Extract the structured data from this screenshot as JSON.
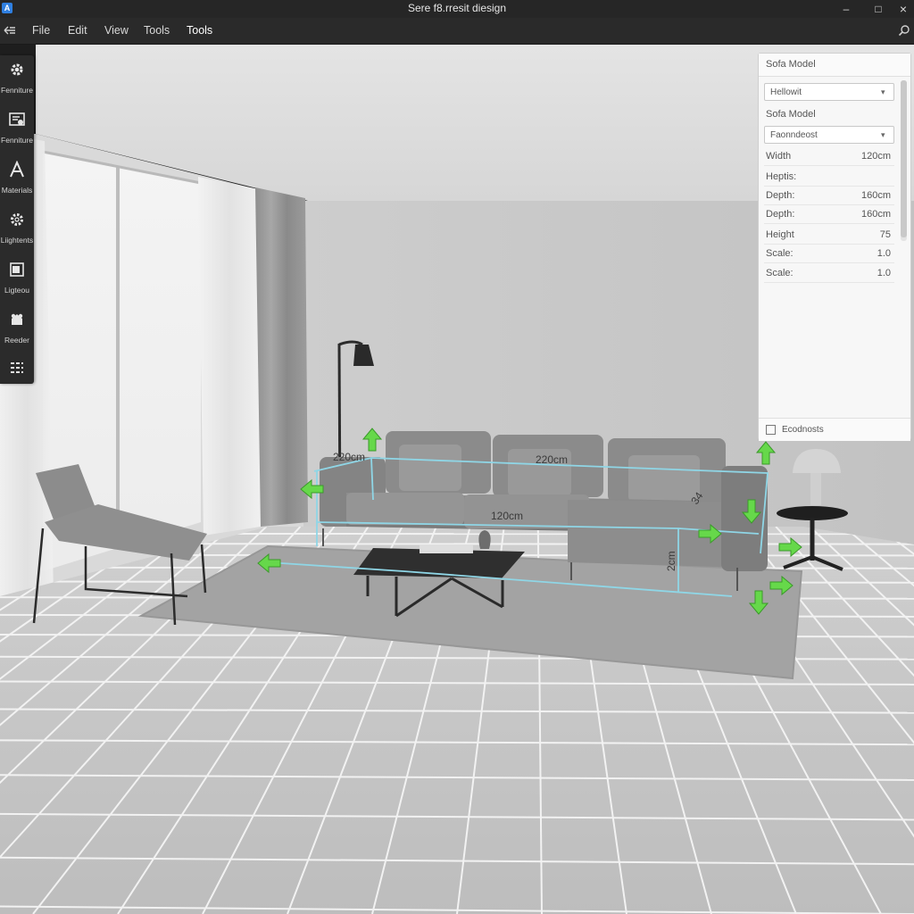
{
  "window": {
    "logo_glyph": "A",
    "title": "Sere f8.rresit diesign",
    "minimize_glyph": "–",
    "maximize_glyph": "□",
    "close_glyph": "×"
  },
  "menu": {
    "file": "File",
    "edit": "Edit",
    "view": "View",
    "tools1": "Tools",
    "tools2": "Tools"
  },
  "toolbar": {
    "items": [
      {
        "label": "Fenniture",
        "icon": "gear-icon"
      },
      {
        "label": "Fenniture",
        "icon": "panel-icon"
      },
      {
        "label": "Materials",
        "icon": "letter-a-icon"
      },
      {
        "label": "Liightents",
        "icon": "settings-icon"
      },
      {
        "label": "Ligteou",
        "icon": "window-icon"
      },
      {
        "label": "Reeder",
        "icon": "render-icon"
      },
      {
        "label": "",
        "icon": "layers-icon"
      }
    ]
  },
  "scene": {
    "dims": {
      "d1": "220cm",
      "d2": "220cm",
      "d3": "120cm",
      "d4": "2cm",
      "d5": "34"
    },
    "colors": {
      "accent_green": "#66d84a",
      "dimension_cyan": "#8fd6e6"
    }
  },
  "panel": {
    "title": "Sofa Model",
    "select1": "Hellowit",
    "subtitle": "Sofa Model",
    "select2": "Faonndeost",
    "rows": [
      {
        "key": "Width",
        "value": "120cm"
      },
      {
        "key": "Heptis:",
        "value": ""
      },
      {
        "key": "Depth:",
        "value": "160cm"
      },
      {
        "key": "Depth:",
        "value": "160cm"
      },
      {
        "key": "Height",
        "value": "75"
      },
      {
        "key": "Scale:",
        "value": "1.0"
      },
      {
        "key": "Scale:",
        "value": "1.0"
      }
    ],
    "footer": "Ecodnosts"
  }
}
